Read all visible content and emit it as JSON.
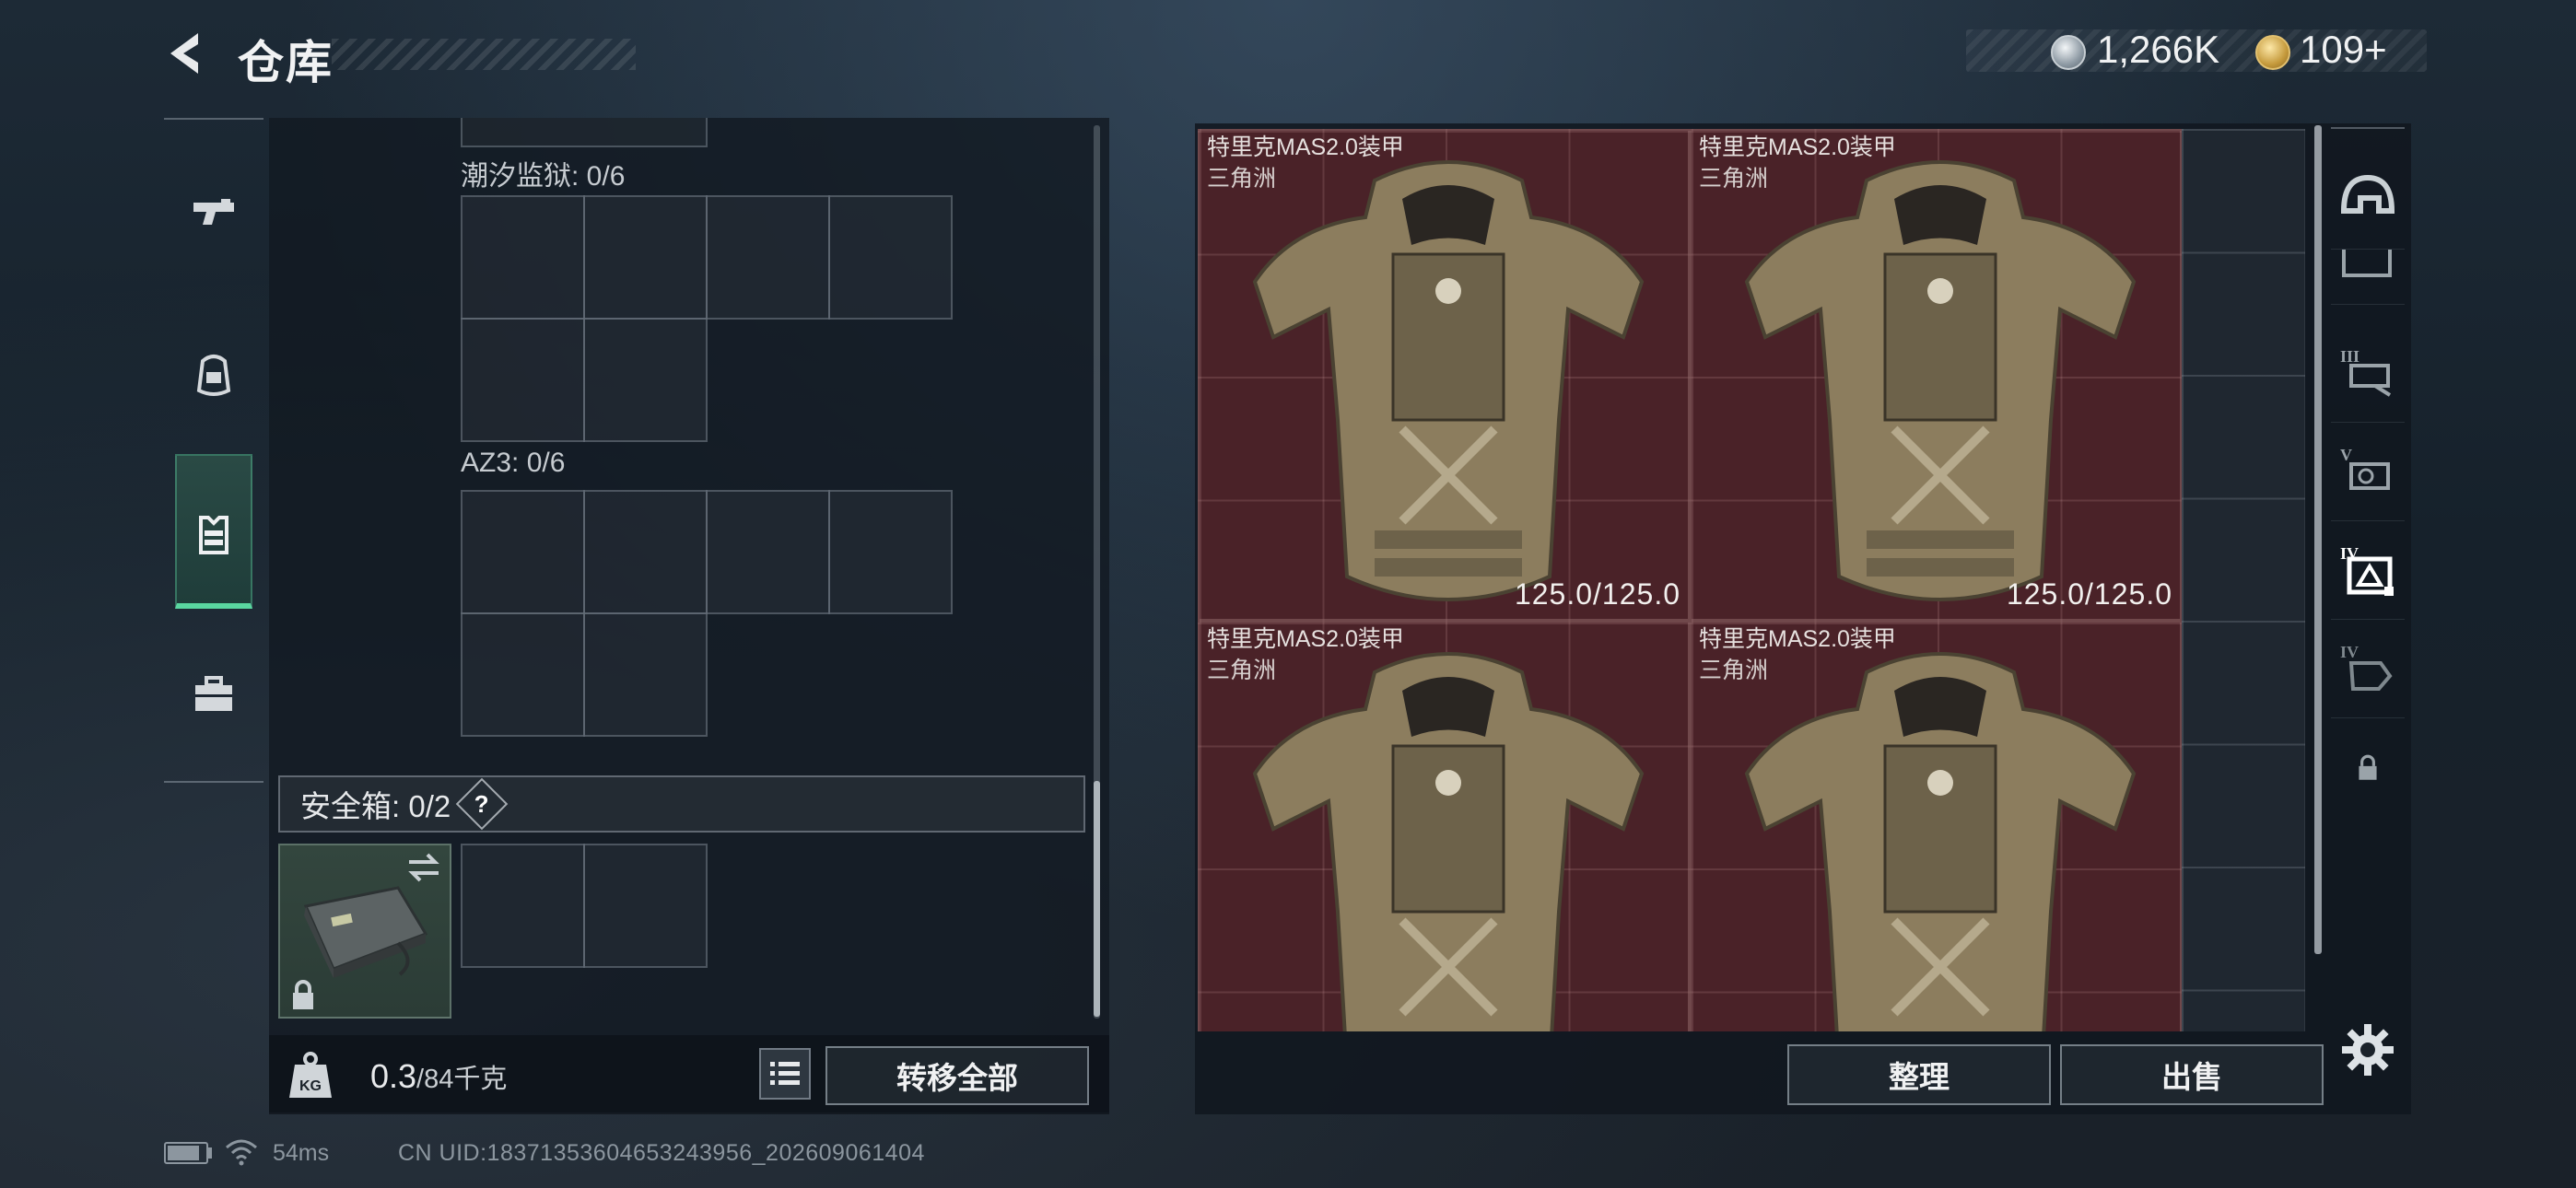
{
  "header": {
    "title": "仓库",
    "currency": {
      "silver": "1,266K",
      "gold": "109+"
    }
  },
  "colors": {
    "accent_green": "#5ad6a0",
    "item_bg_red": "#4a2228"
  },
  "left_nav": {
    "items": [
      {
        "icon": "pistol-icon",
        "active": false
      },
      {
        "icon": "backpack-icon",
        "active": false
      },
      {
        "icon": "chest-rig-icon",
        "active": true
      },
      {
        "icon": "case-icon",
        "active": false
      }
    ]
  },
  "containers": {
    "sections": [
      {
        "label": "潮汐监狱: 0/6"
      },
      {
        "label": "AZ3: 0/6"
      }
    ],
    "safe_box": {
      "label": "安全箱: 0/2",
      "help": "?"
    }
  },
  "footer": {
    "weight_current": "0.3",
    "weight_max": "/84千克",
    "transfer_all": "转移全部"
  },
  "stash": {
    "items": [
      {
        "name": "特里克MAS2.0装甲",
        "map": "三角洲",
        "durability": "125.0/125.0"
      },
      {
        "name": "特里克MAS2.0装甲",
        "map": "三角洲",
        "durability": "125.0/125.0"
      },
      {
        "name": "特里克MAS2.0装甲",
        "map": "三角洲",
        "durability": ""
      },
      {
        "name": "特里克MAS2.0装甲",
        "map": "三角洲",
        "durability": ""
      }
    ],
    "sort": "整理",
    "sell": "出售"
  },
  "category_nav": {
    "items": [
      {
        "icon": "helmet-icon"
      },
      {
        "icon": "armor-level-iii-icon",
        "tier": "III"
      },
      {
        "icon": "armor-level-v-icon",
        "tier": "V"
      },
      {
        "icon": "armor-level-iv-icon",
        "tier": "IV",
        "active": true
      },
      {
        "icon": "armor-level-iv-alt-icon",
        "tier": "IV"
      },
      {
        "icon": "lock-icon"
      }
    ]
  },
  "status": {
    "ping": "54ms",
    "uid": "CN UID:18371353604653243956_202609061404"
  }
}
